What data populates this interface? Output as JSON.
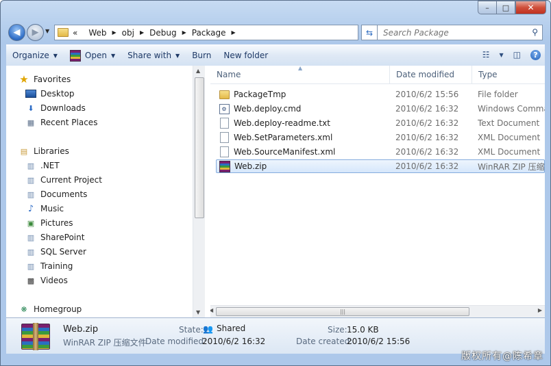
{
  "window": {
    "caption_buttons": {
      "minimize": "–",
      "maximize": "□",
      "close": "✕"
    }
  },
  "address": {
    "history_glyph": "«",
    "crumbs": [
      "Web",
      "obj",
      "Debug",
      "Package"
    ]
  },
  "search": {
    "placeholder": "Search Package"
  },
  "toolbar": {
    "organize": "Organize",
    "open": "Open",
    "share_with": "Share with",
    "burn": "Burn",
    "new_folder": "New folder"
  },
  "sidebar": {
    "favorites_header": "Favorites",
    "favorites": [
      "Desktop",
      "Downloads",
      "Recent Places"
    ],
    "libraries_header": "Libraries",
    "libraries": [
      ".NET",
      "Current Project",
      "Documents",
      "Music",
      "Pictures",
      "SharePoint",
      "SQL Server",
      "Training",
      "Videos"
    ],
    "homegroup": "Homegroup"
  },
  "columns": {
    "name": "Name",
    "date": "Date modified",
    "type": "Type"
  },
  "files": [
    {
      "name": "PackageTmp",
      "date": "2010/6/2 15:56",
      "type": "File folder",
      "icon": "folder-icon"
    },
    {
      "name": "Web.deploy.cmd",
      "date": "2010/6/2 16:32",
      "type": "Windows Comma",
      "icon": "cmd-file-icon"
    },
    {
      "name": "Web.deploy-readme.txt",
      "date": "2010/6/2 16:32",
      "type": "Text Document",
      "icon": "text-file-icon"
    },
    {
      "name": "Web.SetParameters.xml",
      "date": "2010/6/2 16:32",
      "type": "XML Document",
      "icon": "xml-file-icon"
    },
    {
      "name": "Web.SourceManifest.xml",
      "date": "2010/6/2 16:32",
      "type": "XML Document",
      "icon": "xml-file-icon"
    },
    {
      "name": "Web.zip",
      "date": "2010/6/2 16:32",
      "type": "WinRAR ZIP 压缩",
      "icon": "winrar-zip-icon",
      "selected": true
    }
  ],
  "details": {
    "filename": "Web.zip",
    "filetype": "WinRAR ZIP 压缩文件",
    "state_label": "State:",
    "state_value": "Shared",
    "size_label": "Size:",
    "size_value": "15.0 KB",
    "modified_label": "Date modified:",
    "modified_value": "2010/6/2 16:32",
    "created_label": "Date created:",
    "created_value": "2010/6/2 15:56"
  },
  "watermark": "版权所有@陈希章",
  "colors": {
    "selection_border": "#84acdd",
    "title_bar": "#b9d1ee"
  }
}
